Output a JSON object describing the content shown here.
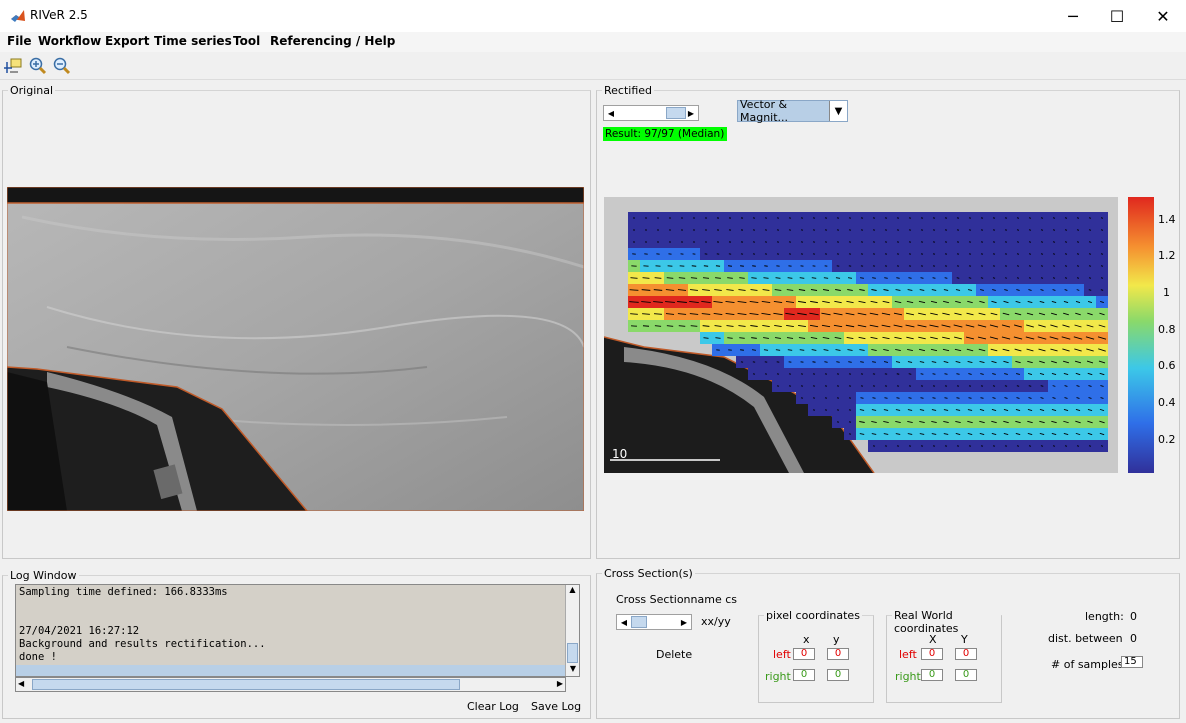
{
  "window": {
    "title": "RIVeR 2.5",
    "minimize": "─",
    "maximize": "☐",
    "close": "✕"
  },
  "menu": [
    "File",
    "Workflow",
    "Export",
    "Time series",
    "Tool",
    "Referencing / Help"
  ],
  "toolbar": [
    "pointer-tool-icon",
    "zoom-in-icon",
    "zoom-out-icon"
  ],
  "original_panel": {
    "title": "Original"
  },
  "rectified_panel": {
    "title": "Rectified",
    "view_select": "Vector & Magnit...",
    "result_status": "Result: 97/97 (Median)",
    "scale_label": "10",
    "colorbar_ticks": [
      "1.4",
      "1.2",
      "1",
      "0.8",
      "0.6",
      "0.4",
      "0.2"
    ]
  },
  "log_window": {
    "title": "Log Window",
    "lines": [
      "Sampling time defined: 166.8333ms",
      "",
      "",
      "27/04/2021 16:27:12",
      "Background and results rectification...",
      "done !"
    ],
    "clear_label": "Clear Log",
    "save_label": "Save Log"
  },
  "cross_section": {
    "title": "Cross Section(s)",
    "name_label": "Cross Sectionname cs",
    "slider_text": "xx/yy",
    "delete_label": "Delete",
    "pixel_group": {
      "title": "pixel coordinates",
      "x": "x",
      "y": "y",
      "left": "left",
      "right": "right",
      "left_x": "0",
      "left_y": "0",
      "right_x": "0",
      "right_y": "0"
    },
    "world_group": {
      "title": "Real World coordinates",
      "x": "X",
      "y": "Y",
      "left": "left",
      "right": "right",
      "left_x": "0",
      "left_y": "0",
      "right_x": "0",
      "right_y": "0"
    },
    "length_label": "length:",
    "length_value": "0",
    "dist_label": "dist. between",
    "dist_value": "0",
    "samples_label": "# of samples:",
    "samples_value": "15"
  },
  "colors": {
    "status_green": "#00ff00",
    "left_red": "#e00000",
    "right_green": "#3a9a1a",
    "select_bg": "#b8cfe6"
  }
}
